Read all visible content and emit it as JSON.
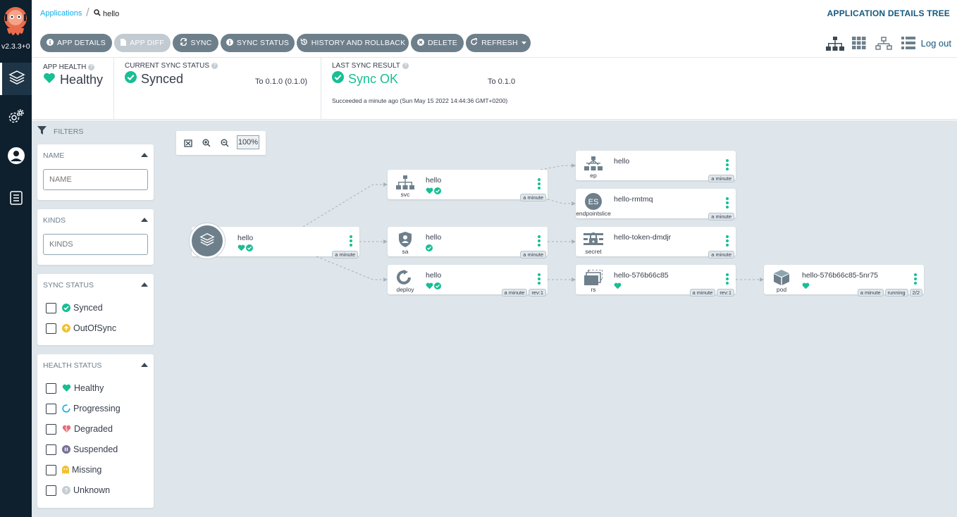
{
  "nav": {
    "version": "v2.3.3+0",
    "items": [
      {
        "name": "applications",
        "icon": "layers-icon"
      },
      {
        "name": "settings",
        "icon": "gear-icon"
      },
      {
        "name": "user-info",
        "icon": "user-icon"
      },
      {
        "name": "docs",
        "icon": "docs-icon"
      }
    ]
  },
  "breadcrumb": {
    "link": "Applications",
    "current": "hello"
  },
  "page_title": "APPLICATION DETAILS TREE",
  "toolbar": {
    "app_details": "APP DETAILS",
    "app_diff": "APP DIFF",
    "sync": "SYNC",
    "sync_status": "SYNC STATUS",
    "history": "HISTORY AND ROLLBACK",
    "delete": "DELETE",
    "refresh": "REFRESH",
    "logout": "Log out"
  },
  "status": {
    "health_label": "APP HEALTH",
    "health_value": "Healthy",
    "sync_label": "CURRENT SYNC STATUS",
    "sync_value": "Synced",
    "sync_to": "To 0.1.0 (0.1.0)",
    "result_label": "LAST SYNC RESULT",
    "result_value": "Sync OK",
    "result_to": "To 0.1.0",
    "result_detail": "Succeeded a minute ago (Sun May 15 2022 14:44:36 GMT+0200)"
  },
  "filters": {
    "header": "FILTERS",
    "name_title": "NAME",
    "name_placeholder": "NAME",
    "kinds_title": "KINDS",
    "kinds_placeholder": "KINDS",
    "sync_title": "SYNC STATUS",
    "sync_options": [
      "Synced",
      "OutOfSync"
    ],
    "health_title": "HEALTH STATUS",
    "health_options": [
      "Healthy",
      "Progressing",
      "Degraded",
      "Suspended",
      "Missing",
      "Unknown"
    ]
  },
  "zoom": {
    "level": "100%"
  },
  "colors": {
    "accent": "#18be94",
    "nav_bg": "#0e1f2e",
    "button": "#6d7f8b",
    "title": "#14587d"
  },
  "tree": {
    "app": {
      "name": "hello",
      "age": "a minute"
    },
    "nodes": [
      {
        "id": "svc",
        "kind": "svc",
        "name": "hello",
        "tags": [
          "a minute"
        ]
      },
      {
        "id": "sa",
        "kind": "sa",
        "name": "hello",
        "tags": [
          "a minute"
        ]
      },
      {
        "id": "deploy",
        "kind": "deploy",
        "name": "hello",
        "tags": [
          "a minute",
          "rev:1"
        ]
      },
      {
        "id": "ep",
        "kind": "ep",
        "name": "hello",
        "tags": [
          "a minute"
        ]
      },
      {
        "id": "es",
        "kind": "endpointslice",
        "name": "hello-rmtmq",
        "icon_text": "ES",
        "tags": [
          "a minute"
        ]
      },
      {
        "id": "secret",
        "kind": "secret",
        "name": "hello-token-dmdjr",
        "tags": [
          "a minute"
        ]
      },
      {
        "id": "rs",
        "kind": "rs",
        "name": "hello-576b66c85",
        "tags": [
          "a minute",
          "rev:1"
        ]
      },
      {
        "id": "pod",
        "kind": "pod",
        "name": "hello-576b66c85-5nr75",
        "tags": [
          "a minute",
          "running",
          "2/2"
        ]
      }
    ]
  }
}
